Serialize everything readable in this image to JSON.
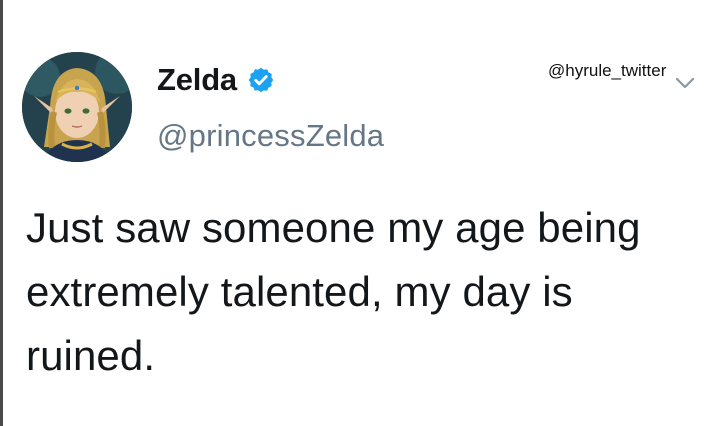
{
  "tweet": {
    "author": {
      "display_name": "Zelda",
      "handle": "@princessZelda",
      "verified": true,
      "avatar_icon": "zelda-portrait-avatar"
    },
    "text": "Just saw someone my age being extremely talented, my day is ruined."
  },
  "watermark": {
    "text": "@hyrule_twitter"
  },
  "icons": {
    "verified": "verified-badge-icon",
    "menu": "chevron-down-icon"
  },
  "colors": {
    "verified_blue": "#1da1f2",
    "handle_gray": "#657786",
    "text": "#14171a",
    "background": "#ffffff"
  }
}
